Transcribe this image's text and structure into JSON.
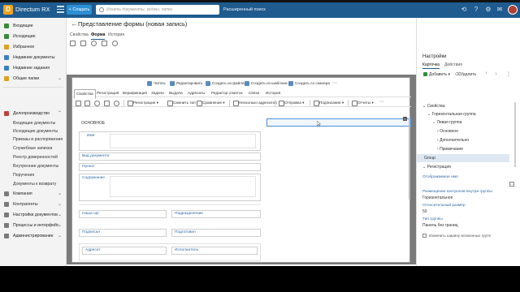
{
  "app": {
    "name": "Directum RX",
    "create_label": "+ Создать",
    "search_placeholder": "Искать документы, задачи, папки",
    "advanced_search": "Расширенный поиск"
  },
  "nav": {
    "items": [
      {
        "label": "Входящие",
        "color": "#3a8a3a"
      },
      {
        "label": "Исходящие",
        "color": "#3a8a3a"
      },
      {
        "label": "Избранное",
        "color": "#e0a020"
      },
      {
        "label": "Недавние документы",
        "color": "#3a7fc1"
      },
      {
        "label": "Недавние задания",
        "color": "#3a7fc1"
      },
      {
        "label": "Общие папки",
        "color": "#e0a020"
      }
    ],
    "section_label": "Делопроизводство",
    "sub_items": [
      "Входящие документы",
      "Исходящие документы",
      "Приказы и распоряжения",
      "Служебные записки",
      "Реестр доверенностей",
      "Внутренние документы",
      "Поручения",
      "Документы к возврату"
    ],
    "bottom_items": [
      "Компания",
      "Контрагенты",
      "Настройки документов",
      "Процессы и интерфейс",
      "Администрирование"
    ]
  },
  "main": {
    "title": "Представление формы (новая запись)",
    "tabs": [
      "Свойства",
      "Форма",
      "История"
    ],
    "active_tab": "Форма",
    "access_label": "Доступ",
    "id_label": "ИД: 66"
  },
  "designer": {
    "actions": [
      "Читать",
      "Редактировать",
      "Создать из файла",
      "Создать из шаблона",
      "Создать со сканера"
    ],
    "tabs": [
      "Свойства",
      "Регистрация",
      "Верификация",
      "Задачи",
      "Выдача",
      "Адресаты",
      "Редактор отметок",
      "Связи",
      "История"
    ],
    "active_tab": "Свойства",
    "commands": [
      "Регистрация",
      "Сменить тип",
      "Сравнение",
      "Несколько адресатов",
      "Отправка",
      "Подписание",
      "Отчеты"
    ],
    "section_title": "ОСНОВНОЕ",
    "fields": [
      "Имя",
      "Вид документа",
      "Проект",
      "Содержание",
      "Наша орг.",
      "Подразделение",
      "Подписал",
      "Подготовил",
      "Адресат",
      "Исполнитель"
    ]
  },
  "settings": {
    "title": "Настройки",
    "tabs": [
      "Карточка",
      "Действия"
    ],
    "active_tab": "Карточка",
    "add_label": "Добавить",
    "delete_label": "Удалить",
    "tree": [
      {
        "label": "Свойства",
        "level": 0
      },
      {
        "label": "Горизонтальная группа",
        "level": 1
      },
      {
        "label": "Левая группа",
        "level": 2
      },
      {
        "label": "Основное",
        "level": 3
      },
      {
        "label": "Дополнительно",
        "level": 3
      },
      {
        "label": "Примечание",
        "level": 3
      },
      {
        "label": "Group",
        "level": 2,
        "selected": true
      },
      {
        "label": "Регистрация",
        "level": 0
      }
    ],
    "props": [
      {
        "label": "Отображаемое имя",
        "value": ""
      },
      {
        "label": "Размещение контролов внутри группы",
        "value": "Горизонтальное"
      },
      {
        "label": "Относительный размер",
        "value": "50"
      },
      {
        "label": "Тип группы",
        "value": "Панель без границ"
      }
    ],
    "checkbox_label": "Изменить ширину вложенных групп"
  }
}
